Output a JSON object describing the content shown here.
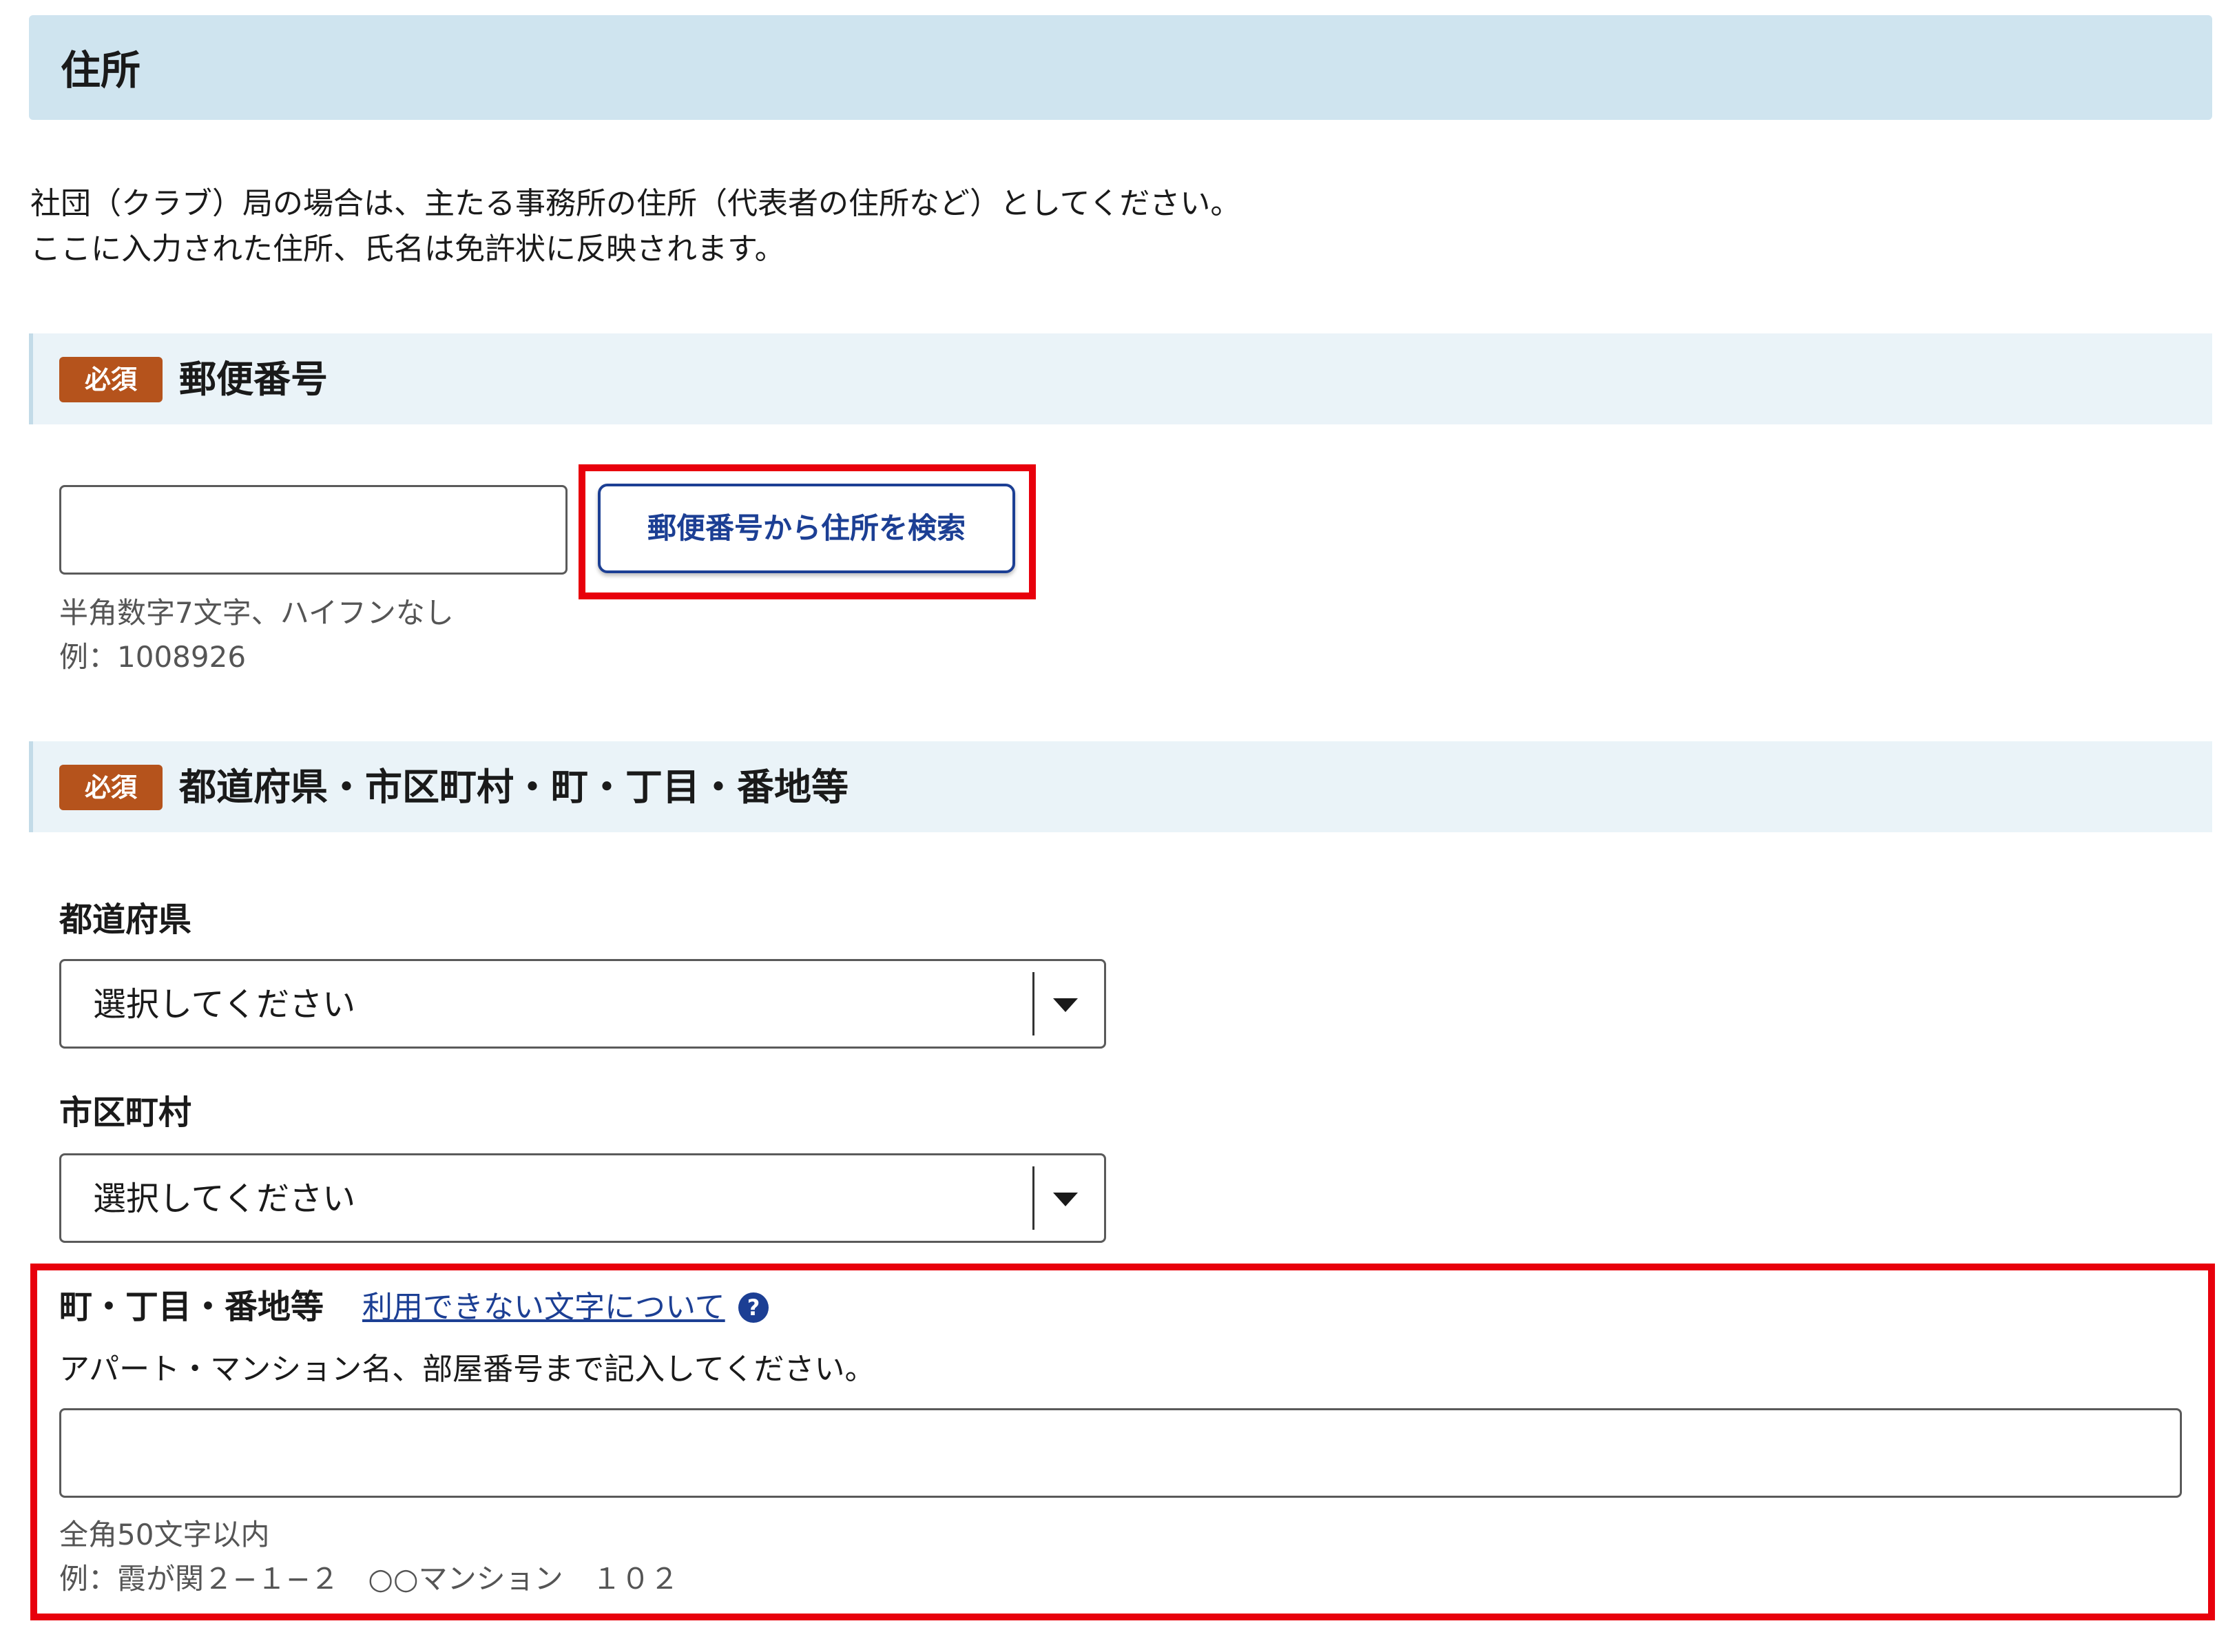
{
  "section": {
    "title": "住所"
  },
  "intro": {
    "line1": "社団（クラブ）局の場合は、主たる事務所の住所（代表者の住所など）としてください。",
    "line2": "ここに入力された住所、氏名は免許状に反映されます。"
  },
  "postal": {
    "badge": "必須",
    "label": "郵便番号",
    "value": "",
    "search_button": "郵便番号から住所を検索",
    "hint1": "半角数字7文字、ハイフンなし",
    "hint2": "例：1008926"
  },
  "address": {
    "badge": "必須",
    "label": "都道府県・市区町村・町・丁目・番地等",
    "prefecture": {
      "label": "都道府県",
      "selected": "選択してください"
    },
    "city": {
      "label": "市区町村",
      "selected": "選択してください"
    },
    "street": {
      "label": "町・丁目・番地等",
      "link": "利用できない文字について",
      "help_icon": "?",
      "description": "アパート・マンション名、部屋番号まで記入してください。",
      "value": "",
      "hint1": "全角50文字以内",
      "hint2": "例：霞が関２−１−２　○○マンション　１０２"
    }
  },
  "colors": {
    "section_bg": "#cfe4ef",
    "field_header_bg": "#eaf3f8",
    "badge": "#b5531c",
    "accent_blue": "#1c3f94",
    "highlight_red": "#e8000c"
  }
}
